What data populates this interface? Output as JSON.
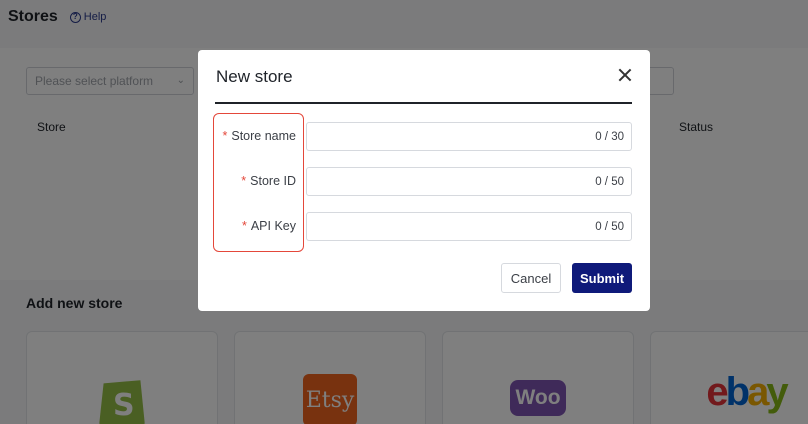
{
  "page": {
    "title": "Stores",
    "help_label": "Help"
  },
  "filters": {
    "platform_placeholder": "Please select platform"
  },
  "table": {
    "columns": [
      "Store",
      "Status"
    ]
  },
  "add_section": {
    "title": "Add new store",
    "platforms": [
      {
        "name": "Shopify",
        "icon": "shopify-logo",
        "glyph": "S",
        "color": "#95bf47"
      },
      {
        "name": "Etsy",
        "icon": "etsy-logo",
        "glyph": "Etsy",
        "color": "#f1641e"
      },
      {
        "name": "WooCommerce",
        "icon": "woo-logo",
        "glyph": "Woo",
        "color": "#7f54b3"
      },
      {
        "name": "eBay",
        "icon": "ebay-logo",
        "glyph": "ebay",
        "colors": [
          "#e53238",
          "#0064d2",
          "#f5af02",
          "#86b817"
        ]
      }
    ]
  },
  "modal": {
    "title": "New store",
    "fields": [
      {
        "label": "Store name",
        "required_mark": "*",
        "counter": "0 / 30",
        "value": ""
      },
      {
        "label": "Store ID",
        "required_mark": "*",
        "counter": "0 / 50",
        "value": ""
      },
      {
        "label": "API Key",
        "required_mark": "*",
        "counter": "0 / 50",
        "value": ""
      }
    ],
    "cancel_label": "Cancel",
    "submit_label": "Submit"
  },
  "colors": {
    "primary": "#0f1a7a",
    "required": "#e4473a",
    "highlight": "#e4473a"
  }
}
